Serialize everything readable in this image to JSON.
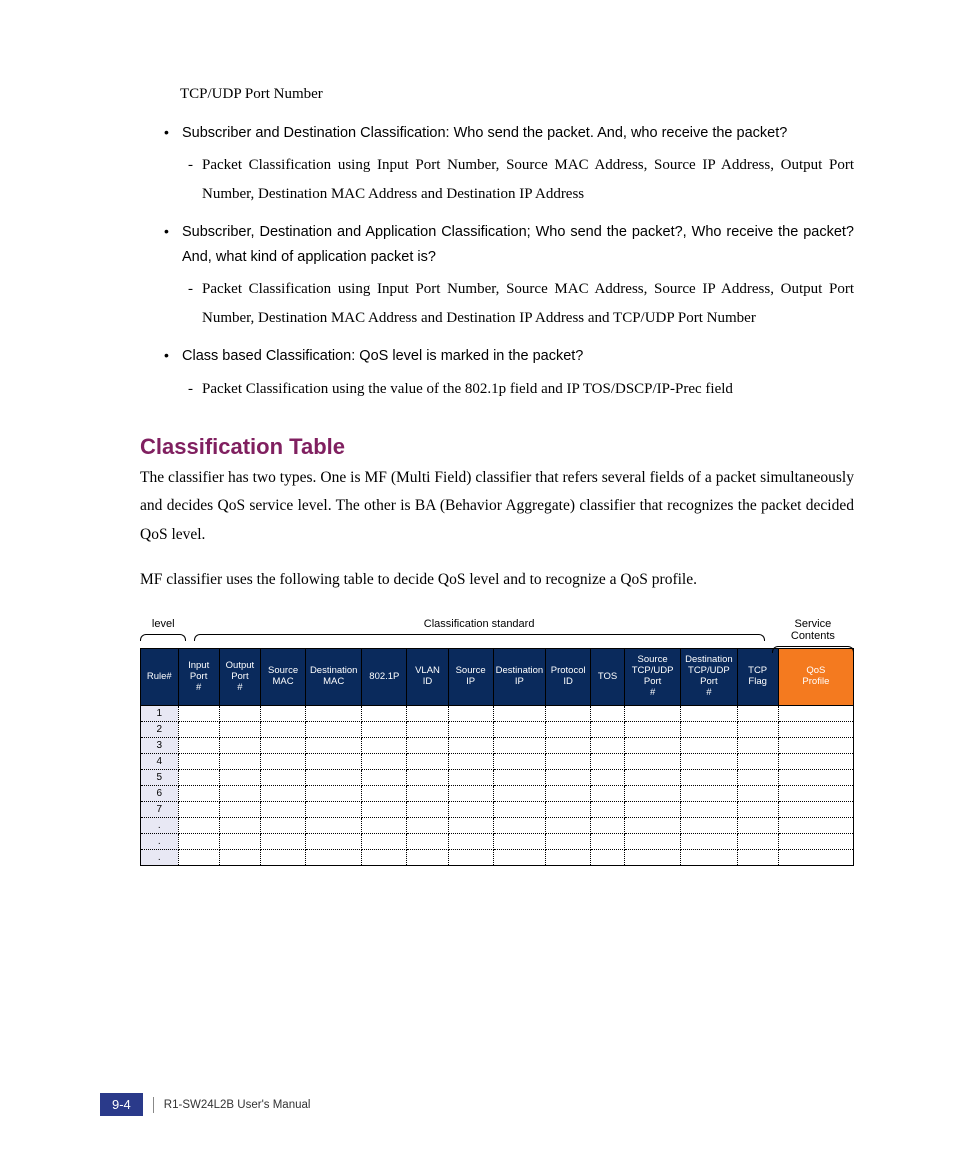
{
  "intro_line": "TCP/UDP Port Number",
  "bullets": [
    {
      "title": "Subscriber and Destination Classification: Who send the packet. And, who receive the packet?",
      "sub": "Packet Classification using Input Port Number, Source MAC Address, Source IP Address, Output Port Number, Destination MAC Address and Destination IP Address"
    },
    {
      "title": "Subscriber, Destination and Application Classification; Who send the packet?, Who receive the packet? And, what kind of application packet is?",
      "sub": "Packet Classification using Input Port Number, Source MAC Address, Source IP Address, Output Port Number, Destination MAC Address and Destination IP Address and TCP/UDP Port Number"
    },
    {
      "title": "Class based Classification: QoS level is marked in the packet?",
      "sub": "Packet Classification using the value of the 802.1p field and IP TOS/DSCP/IP-Prec field"
    }
  ],
  "section_heading": "Classification Table",
  "para1": "The classifier has two types. One is MF (Multi Field) classifier that refers several fields of a packet simultaneously and decides QoS service level. The other is BA (Behavior Aggregate) classifier that recognizes the packet decided QoS level.",
  "para2": "MF classifier uses the following table to decide QoS level and to recognize a QoS profile.",
  "brace_labels": {
    "level": "level",
    "standard": "Classification standard",
    "service": "Service Contents"
  },
  "table": {
    "headers": [
      "Rule#",
      "Input Port #",
      "Output Port #",
      "Source MAC",
      "Destination MAC",
      "802.1P",
      "VLAN ID",
      "Source IP",
      "Destination IP",
      "Protocol ID",
      "TOS",
      "Source TCP/UDP Port #",
      "Destination TCP/UDP Port #",
      "TCP Flag",
      "QoS Profile"
    ],
    "rows": [
      "1",
      "2",
      "3",
      "4",
      "5",
      "6",
      "7",
      ".",
      ".",
      "."
    ]
  },
  "footer": {
    "page": "9-4",
    "doc": "R1-SW24L2B   User's Manual"
  }
}
